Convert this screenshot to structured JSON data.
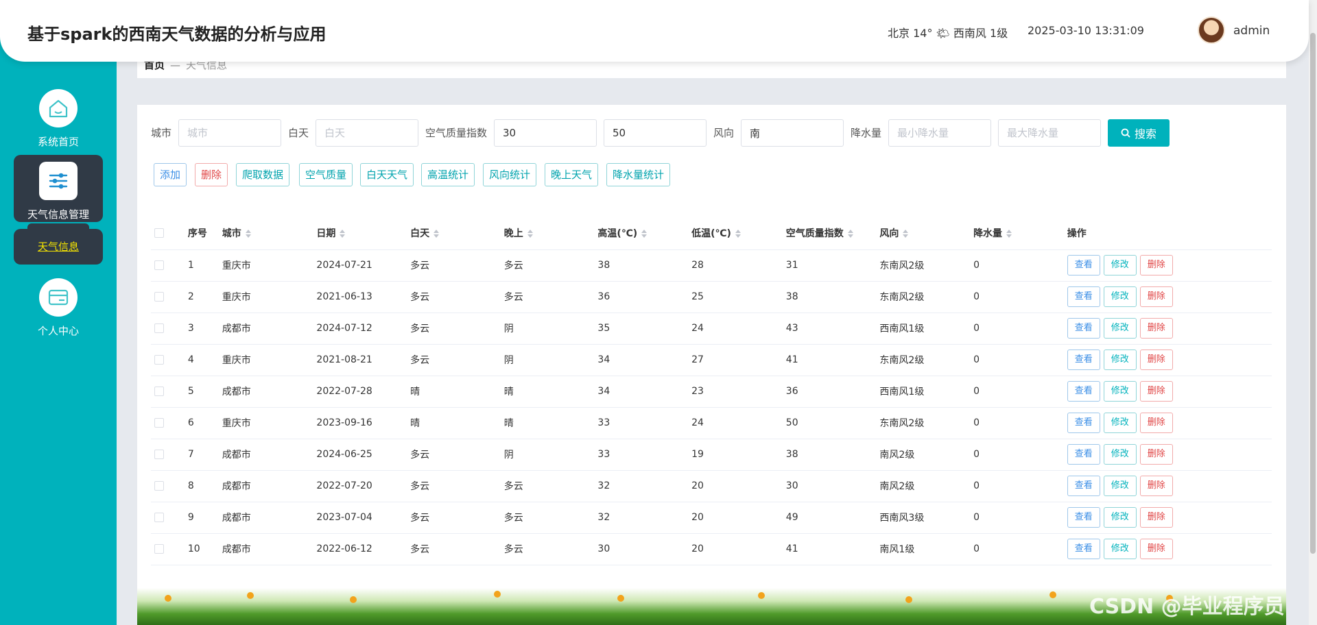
{
  "header": {
    "title": "基于spark的西南天气数据的分析与应用",
    "weather": "北京  14°  🌤  西南风  1级",
    "datetime": "2025-03-10 13:31:09",
    "username": "admin"
  },
  "sidebar": {
    "home": "系统首页",
    "weather_mgmt": "天气信息管理",
    "weather_info": "天气信息",
    "personal": "个人中心"
  },
  "breadcrumb": {
    "home": "首页",
    "current": "天气信息"
  },
  "filters": {
    "city_label": "城市",
    "city_placeholder": "城市",
    "city_value": "",
    "day_label": "白天",
    "day_placeholder": "白天",
    "day_value": "",
    "aqi_label": "空气质量指数",
    "aqi_min": "30",
    "aqi_max": "50",
    "wind_label": "风向",
    "wind_value": "南",
    "rain_label": "降水量",
    "rain_min_placeholder": "最小降水量",
    "rain_max_placeholder": "最大降水量",
    "search": "搜索"
  },
  "actions": {
    "add": "添加",
    "delete": "删除",
    "crawl": "爬取数据",
    "air": "空气质量",
    "day_weather": "白天天气",
    "high_temp": "高温统计",
    "wind_stats": "风向统计",
    "night_weather": "晚上天气",
    "rain_stats": "降水量统计"
  },
  "table": {
    "headers": [
      "序号",
      "城市",
      "日期",
      "白天",
      "晚上",
      "高温(℃)",
      "低温(℃)",
      "空气质量指数",
      "风向",
      "降水量",
      "操作"
    ],
    "view": "查看",
    "edit": "修改",
    "del": "删除",
    "rows": [
      [
        "1",
        "重庆市",
        "2024-07-21",
        "多云",
        "多云",
        "38",
        "28",
        "31",
        "东南风2级",
        "0"
      ],
      [
        "2",
        "重庆市",
        "2021-06-13",
        "多云",
        "多云",
        "36",
        "25",
        "38",
        "东南风2级",
        "0"
      ],
      [
        "3",
        "成都市",
        "2024-07-12",
        "多云",
        "阴",
        "35",
        "24",
        "43",
        "西南风1级",
        "0"
      ],
      [
        "4",
        "重庆市",
        "2021-08-21",
        "多云",
        "阴",
        "34",
        "27",
        "41",
        "东南风2级",
        "0"
      ],
      [
        "5",
        "成都市",
        "2022-07-28",
        "晴",
        "晴",
        "34",
        "23",
        "36",
        "西南风1级",
        "0"
      ],
      [
        "6",
        "重庆市",
        "2023-09-16",
        "晴",
        "晴",
        "33",
        "24",
        "50",
        "东南风2级",
        "0"
      ],
      [
        "7",
        "成都市",
        "2024-06-25",
        "多云",
        "阴",
        "33",
        "19",
        "38",
        "南风2级",
        "0"
      ],
      [
        "8",
        "成都市",
        "2022-07-20",
        "多云",
        "多云",
        "32",
        "20",
        "30",
        "南风2级",
        "0"
      ],
      [
        "9",
        "成都市",
        "2023-07-04",
        "多云",
        "多云",
        "32",
        "20",
        "49",
        "西南风3级",
        "0"
      ],
      [
        "10",
        "成都市",
        "2022-06-12",
        "多云",
        "多云",
        "30",
        "20",
        "41",
        "南风1级",
        "0"
      ]
    ]
  },
  "watermark": "CSDN @毕业程序员",
  "colors": {
    "accent": "#00b2bc",
    "sidebar_active": "#303a46",
    "danger": "#e04545",
    "info": "#3a8ee6"
  }
}
